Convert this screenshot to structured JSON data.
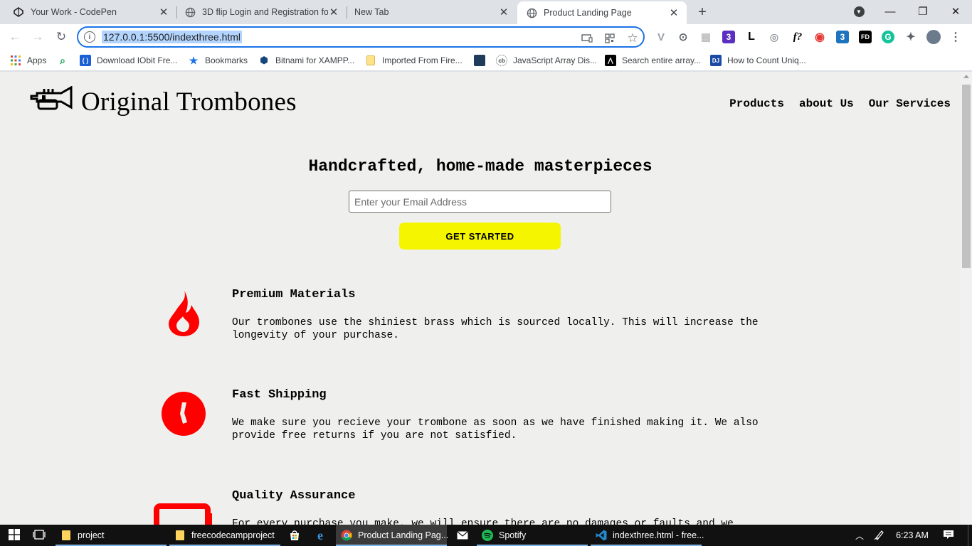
{
  "browser": {
    "tabs": [
      {
        "title": "Your Work - CodePen",
        "icon": "codepen-icon",
        "close": "✕"
      },
      {
        "title": "3D flip Login and Registration fo",
        "icon": "globe-icon",
        "close": "✕"
      },
      {
        "title": "New Tab",
        "icon": "",
        "close": "✕"
      },
      {
        "title": "Product Landing Page",
        "icon": "globe-icon",
        "close": "✕"
      }
    ],
    "new_tab": "+",
    "window_controls": {
      "minimize": "—",
      "restore": "❐",
      "close": "✕"
    },
    "nav": {
      "back": "←",
      "forward": "→",
      "reload": "↻"
    },
    "address": {
      "url": "127.0.0.1:5500/indexthree.html",
      "info": "i"
    },
    "extensions": [
      "V",
      "⊙",
      "▦",
      "3",
      "L",
      "◎",
      "f?",
      "◉",
      "3",
      "FD",
      "G",
      "✦"
    ],
    "bookmarks": [
      {
        "label": "Apps",
        "icon": "apps-grid-icon"
      },
      {
        "label": "",
        "icon": "magnifier-icon"
      },
      {
        "label": "Download IObit Fre...",
        "icon": "iobit-icon"
      },
      {
        "label": "Bookmarks",
        "icon": "star-icon"
      },
      {
        "label": "Bitnami for XAMPP...",
        "icon": "bitnami-icon"
      },
      {
        "label": "Imported From Fire...",
        "icon": "folder-icon"
      },
      {
        "label": "",
        "icon": "site-icon"
      },
      {
        "label": "JavaScript Array Dis...",
        "icon": "js-site-icon"
      },
      {
        "label": "Search entire array...",
        "icon": "search-site-icon"
      },
      {
        "label": "How to Count Uniq...",
        "icon": "dj-icon"
      }
    ]
  },
  "page": {
    "brand": "Original Trombones",
    "nav": [
      "Products",
      "about Us",
      "Our Services"
    ],
    "hero": {
      "title": "Handcrafted, home-made masterpieces",
      "email_placeholder": "Enter your Email Address",
      "cta": "GET STARTED"
    },
    "features": [
      {
        "title": "Premium Materials",
        "text": "Our trombones use the shiniest brass which is sourced locally. This will increase the longevity of your purchase.",
        "icon": "fire-icon"
      },
      {
        "title": "Fast Shipping",
        "text": "We make sure you recieve your trombone as soon as we have finished making it. We also provide free returns if you are not satisfied.",
        "icon": "clock-icon"
      },
      {
        "title": "Quality Assurance",
        "text": "For every purchase you make, we will ensure there are no damages or faults and we",
        "icon": "battery-icon"
      }
    ],
    "accent_color": "#ff0000",
    "cta_color": "#f5f500"
  },
  "taskbar": {
    "items": [
      {
        "label": "project",
        "icon": "folder-icon"
      },
      {
        "label": "freecodecampproject",
        "icon": "folder-icon"
      },
      {
        "label": "",
        "icon": "store-icon"
      },
      {
        "label": "",
        "icon": "edge-icon"
      },
      {
        "label": "Product Landing Pag...",
        "icon": "chrome-icon"
      },
      {
        "label": "",
        "icon": "mail-icon"
      },
      {
        "label": "Spotify",
        "icon": "spotify-icon"
      },
      {
        "label": "indexthree.html - free...",
        "icon": "vscode-icon"
      }
    ],
    "time": "6:23 AM"
  }
}
